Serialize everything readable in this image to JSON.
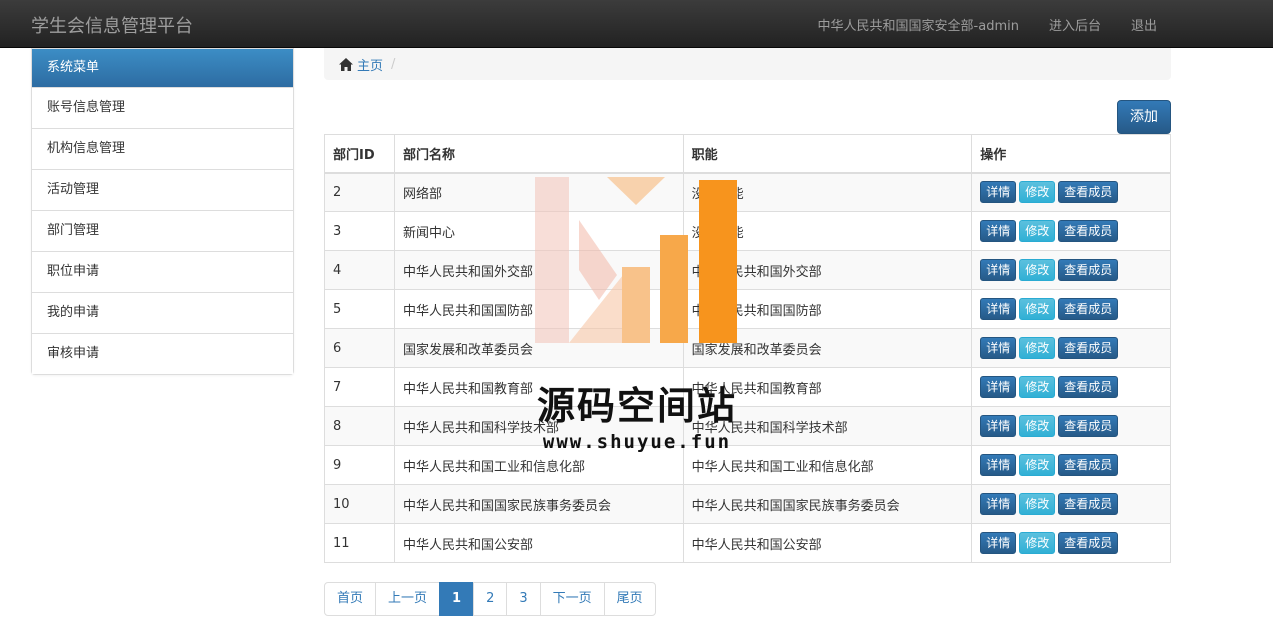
{
  "navbar": {
    "brand": "学生会信息管理平台",
    "user": "中华人民共和国国家安全部-admin",
    "admin_link": "进入后台",
    "logout": "退出"
  },
  "sidebar": {
    "heading": "系统菜单",
    "items": [
      {
        "label": "账号信息管理"
      },
      {
        "label": "机构信息管理"
      },
      {
        "label": "活动管理"
      },
      {
        "label": "部门管理"
      },
      {
        "label": "职位申请"
      },
      {
        "label": "我的申请"
      },
      {
        "label": "审核申请"
      }
    ]
  },
  "breadcrumb": {
    "home": "主页",
    "separator": "/"
  },
  "add_button": "添加",
  "table": {
    "headers": {
      "id": "部门ID",
      "name": "部门名称",
      "function": "职能",
      "ops": "操作"
    },
    "buttons": {
      "detail": "详情",
      "edit": "修改",
      "members": "查看成员"
    },
    "rows": [
      {
        "id": "2",
        "name": "网络部",
        "function": "没有职能"
      },
      {
        "id": "3",
        "name": "新闻中心",
        "function": "没有职能"
      },
      {
        "id": "4",
        "name": "中华人民共和国外交部",
        "function": "中华人民共和国外交部"
      },
      {
        "id": "5",
        "name": "中华人民共和国国防部",
        "function": "中华人民共和国国防部"
      },
      {
        "id": "6",
        "name": "国家发展和改革委员会",
        "function": "国家发展和改革委员会"
      },
      {
        "id": "7",
        "name": "中华人民共和国教育部",
        "function": "中华人民共和国教育部"
      },
      {
        "id": "8",
        "name": "中华人民共和国科学技术部",
        "function": "中华人民共和国科学技术部"
      },
      {
        "id": "9",
        "name": "中华人民共和国工业和信息化部",
        "function": "中华人民共和国工业和信息化部"
      },
      {
        "id": "10",
        "name": "中华人民共和国国家民族事务委员会",
        "function": "中华人民共和国国家民族事务委员会"
      },
      {
        "id": "11",
        "name": "中华人民共和国公安部",
        "function": "中华人民共和国公安部"
      }
    ]
  },
  "pagination": {
    "first": "首页",
    "prev": "上一页",
    "pages": [
      "1",
      "2",
      "3"
    ],
    "active": "1",
    "next": "下一页",
    "last": "尾页"
  },
  "watermark": {
    "text": "源码空间站",
    "url": "www.shuyue.fun"
  },
  "colors": {
    "primary": "#337ab7",
    "info": "#5bc0de",
    "navbar": "#222222",
    "watermark_orange": "#f7941d"
  }
}
